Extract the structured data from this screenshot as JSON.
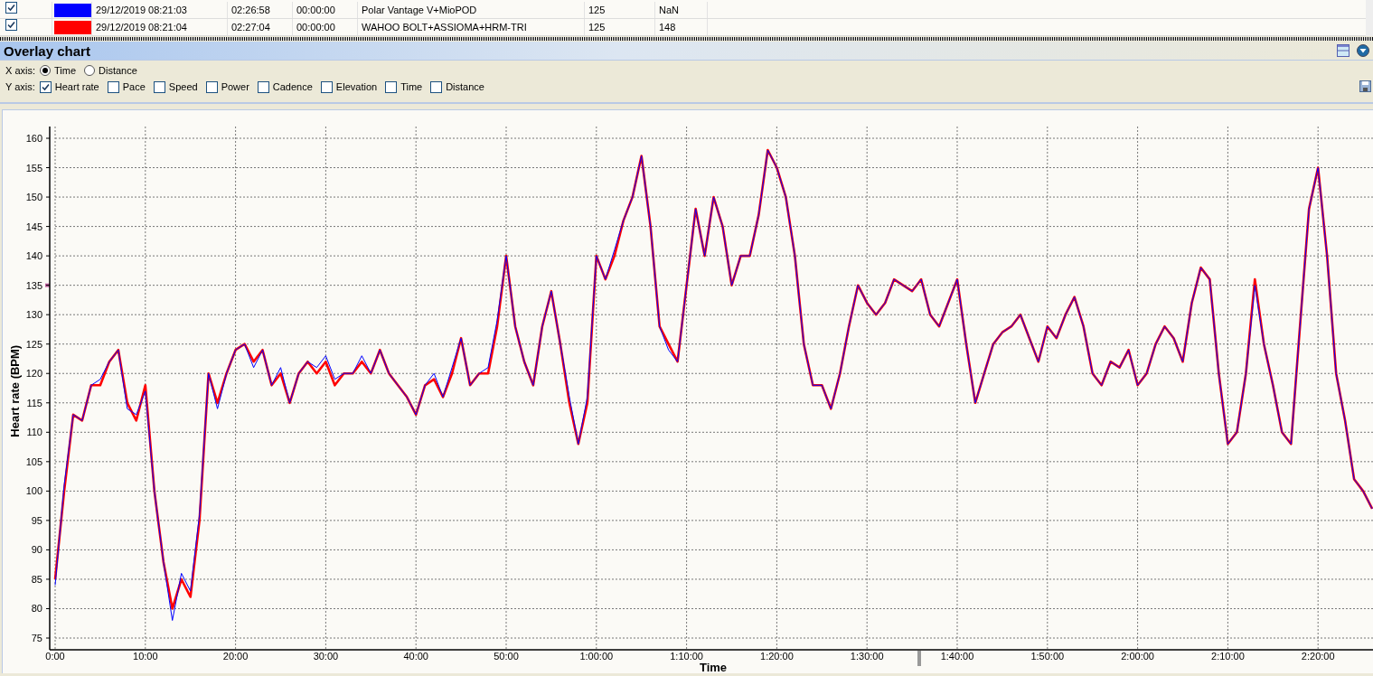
{
  "sessions": [
    {
      "checked": true,
      "color": "#0000ff",
      "start": "29/12/2019 08:21:03",
      "duration": "02:26:58",
      "offset": "00:00:00",
      "device": "Polar Vantage V+MioPOD",
      "value_1": "125",
      "value_2": "NaN"
    },
    {
      "checked": true,
      "color": "#ff0000",
      "start": "29/12/2019 08:21:04",
      "duration": "02:27:04",
      "offset": "00:00:00",
      "device": "WAHOO BOLT+ASSIOMA+HRM-TRI",
      "value_1": "125",
      "value_2": "148"
    }
  ],
  "panel": {
    "title": "Overlay chart"
  },
  "x_axis": {
    "label": "X axis:",
    "options": [
      {
        "label": "Time",
        "selected": true
      },
      {
        "label": "Distance",
        "selected": false
      }
    ]
  },
  "y_axis": {
    "label": "Y axis:",
    "options": [
      {
        "label": "Heart rate",
        "checked": true
      },
      {
        "label": "Pace",
        "checked": false
      },
      {
        "label": "Speed",
        "checked": false
      },
      {
        "label": "Power",
        "checked": false
      },
      {
        "label": "Cadence",
        "checked": false
      },
      {
        "label": "Elevation",
        "checked": false
      },
      {
        "label": "Time",
        "checked": false
      },
      {
        "label": "Distance",
        "checked": false
      }
    ]
  },
  "chart": {
    "chart_data": {
      "type": "line",
      "xlabel": "Time",
      "ylabel": "Heart rate (BPM)",
      "grid": true,
      "xlim": [
        0,
        146
      ],
      "ylim": [
        73,
        162
      ],
      "xticks": [
        {
          "value": 0,
          "label": "0:00"
        },
        {
          "value": 10,
          "label": "10:00"
        },
        {
          "value": 20,
          "label": "20:00"
        },
        {
          "value": 30,
          "label": "30:00"
        },
        {
          "value": 40,
          "label": "40:00"
        },
        {
          "value": 50,
          "label": "50:00"
        },
        {
          "value": 60,
          "label": "1:00:00"
        },
        {
          "value": 70,
          "label": "1:10:00"
        },
        {
          "value": 80,
          "label": "1:20:00"
        },
        {
          "value": 90,
          "label": "1:30:00"
        },
        {
          "value": 100,
          "label": "1:40:00"
        },
        {
          "value": 110,
          "label": "1:50:00"
        },
        {
          "value": 120,
          "label": "2:00:00"
        },
        {
          "value": 130,
          "label": "2:10:00"
        },
        {
          "value": 140,
          "label": "2:20:00"
        }
      ],
      "yticks": [
        75,
        80,
        85,
        90,
        95,
        100,
        105,
        110,
        115,
        120,
        125,
        130,
        135,
        140,
        145,
        150,
        155,
        160
      ],
      "x": [
        0,
        1,
        2,
        3,
        4,
        5,
        6,
        7,
        8,
        9,
        10,
        11,
        12,
        13,
        14,
        15,
        16,
        17,
        18,
        19,
        20,
        21,
        22,
        23,
        24,
        25,
        26,
        27,
        28,
        29,
        30,
        31,
        32,
        33,
        34,
        35,
        36,
        37,
        38,
        39,
        40,
        41,
        42,
        43,
        44,
        45,
        46,
        47,
        48,
        49,
        50,
        51,
        52,
        53,
        54,
        55,
        56,
        57,
        58,
        59,
        60,
        61,
        62,
        63,
        64,
        65,
        66,
        67,
        68,
        69,
        70,
        71,
        72,
        73,
        74,
        75,
        76,
        77,
        78,
        79,
        80,
        81,
        82,
        83,
        84,
        85,
        86,
        87,
        88,
        89,
        90,
        91,
        92,
        93,
        94,
        95,
        96,
        97,
        98,
        99,
        100,
        101,
        102,
        103,
        104,
        105,
        106,
        107,
        108,
        109,
        110,
        111,
        112,
        113,
        114,
        115,
        116,
        117,
        118,
        119,
        120,
        121,
        122,
        123,
        124,
        125,
        126,
        127,
        128,
        129,
        130,
        131,
        132,
        133,
        134,
        135,
        136,
        137,
        138,
        139,
        140,
        141,
        142,
        143,
        144,
        145,
        146
      ],
      "series": [
        {
          "color": "#0000ff",
          "values": [
            84,
            101,
            113,
            112,
            118,
            119,
            122,
            124,
            114,
            113,
            117,
            100,
            88,
            78,
            86,
            83,
            96,
            120,
            114,
            120,
            124,
            125,
            121,
            124,
            118,
            121,
            115,
            120,
            122,
            121,
            123,
            119,
            120,
            120,
            123,
            120,
            124,
            120,
            118,
            116,
            113,
            118,
            120,
            116,
            121,
            126,
            118,
            120,
            121,
            129,
            140,
            128,
            122,
            118,
            128,
            134,
            125,
            116,
            108,
            116,
            140,
            136,
            141,
            146,
            150,
            157,
            145,
            128,
            124,
            122,
            135,
            148,
            140,
            150,
            145,
            135,
            140,
            140,
            147,
            158,
            155,
            150,
            140,
            125,
            118,
            118,
            114,
            120,
            128,
            135,
            132,
            130,
            132,
            136,
            135,
            134,
            136,
            130,
            128,
            132,
            136,
            125,
            115,
            120,
            125,
            127,
            128,
            130,
            126,
            122,
            128,
            126,
            130,
            133,
            128,
            120,
            118,
            122,
            121,
            124,
            118,
            120,
            125,
            128,
            126,
            122,
            132,
            138,
            136,
            120,
            108,
            110,
            120,
            135,
            125,
            118,
            110,
            108,
            128,
            148,
            155,
            140,
            120,
            112,
            102,
            100,
            97
          ]
        },
        {
          "color": "#ff0000",
          "values": [
            85,
            100,
            113,
            112,
            118,
            118,
            122,
            124,
            115,
            112,
            118,
            100,
            88,
            80,
            85,
            82,
            95,
            120,
            115,
            120,
            124,
            125,
            122,
            124,
            118,
            120,
            115,
            120,
            122,
            120,
            122,
            118,
            120,
            120,
            122,
            120,
            124,
            120,
            118,
            116,
            113,
            118,
            119,
            116,
            120,
            126,
            118,
            120,
            120,
            128,
            140,
            128,
            122,
            118,
            128,
            134,
            125,
            115,
            108,
            115,
            140,
            136,
            140,
            146,
            150,
            157,
            145,
            128,
            125,
            122,
            135,
            148,
            140,
            150,
            145,
            135,
            140,
            140,
            147,
            158,
            155,
            150,
            140,
            125,
            118,
            118,
            114,
            120,
            128,
            135,
            132,
            130,
            132,
            136,
            135,
            134,
            136,
            130,
            128,
            132,
            136,
            125,
            115,
            120,
            125,
            127,
            128,
            130,
            126,
            122,
            128,
            126,
            130,
            133,
            128,
            120,
            118,
            122,
            121,
            124,
            118,
            120,
            125,
            128,
            126,
            122,
            132,
            138,
            136,
            120,
            108,
            110,
            120,
            136,
            125,
            118,
            110,
            108,
            128,
            148,
            155,
            140,
            120,
            112,
            102,
            100,
            97
          ]
        }
      ]
    }
  }
}
